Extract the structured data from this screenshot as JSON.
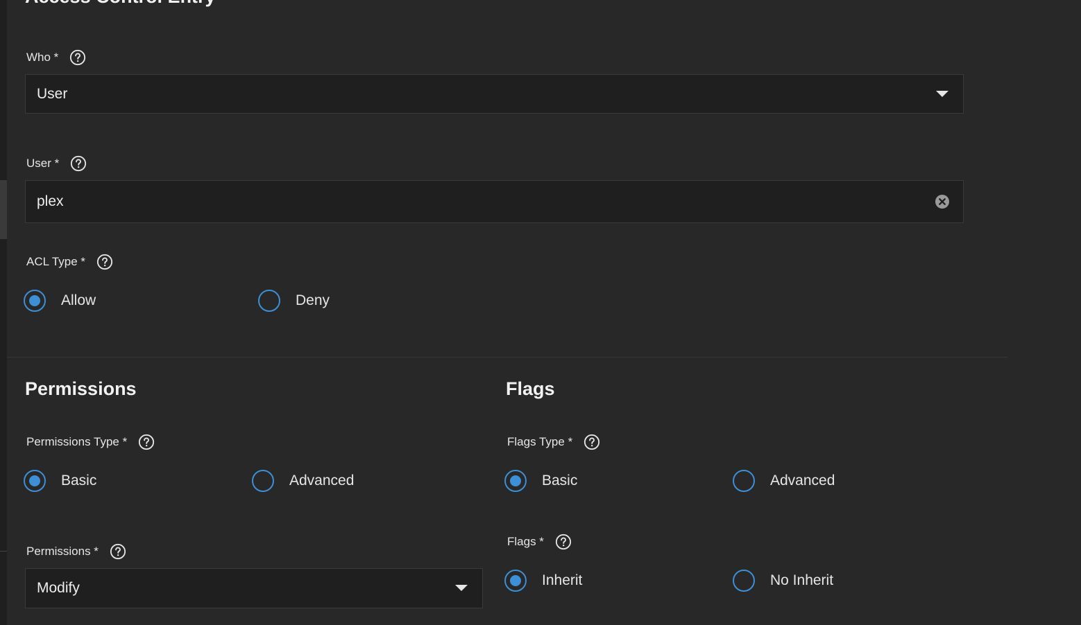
{
  "header": {
    "title": "Access Control Entry"
  },
  "who": {
    "label": "Who *",
    "value": "User"
  },
  "user": {
    "label": "User *",
    "value": "plex"
  },
  "acl_type": {
    "label": "ACL Type *",
    "options": [
      {
        "label": "Allow",
        "selected": true
      },
      {
        "label": "Deny",
        "selected": false
      }
    ]
  },
  "permissions": {
    "title": "Permissions",
    "type_label": "Permissions Type *",
    "type_options": [
      {
        "label": "Basic",
        "selected": true
      },
      {
        "label": "Advanced",
        "selected": false
      }
    ],
    "permissions_label": "Permissions *",
    "permissions_value": "Modify"
  },
  "flags": {
    "title": "Flags",
    "type_label": "Flags Type *",
    "type_options": [
      {
        "label": "Basic",
        "selected": true
      },
      {
        "label": "Advanced",
        "selected": false
      }
    ],
    "flags_label": "Flags *",
    "flags_options": [
      {
        "label": "Inherit",
        "selected": true
      },
      {
        "label": "No Inherit",
        "selected": false
      }
    ]
  },
  "colors": {
    "background": "#282828",
    "field_background": "#1f1f1f",
    "accent": "#3d8fd6",
    "text": "#e6e6e6"
  },
  "icons": {
    "help": "help-circle-icon",
    "dropdown": "caret-down-icon",
    "clear": "clear-circle-icon",
    "radio_on": "radio-checked-icon",
    "radio_off": "radio-unchecked-icon"
  }
}
